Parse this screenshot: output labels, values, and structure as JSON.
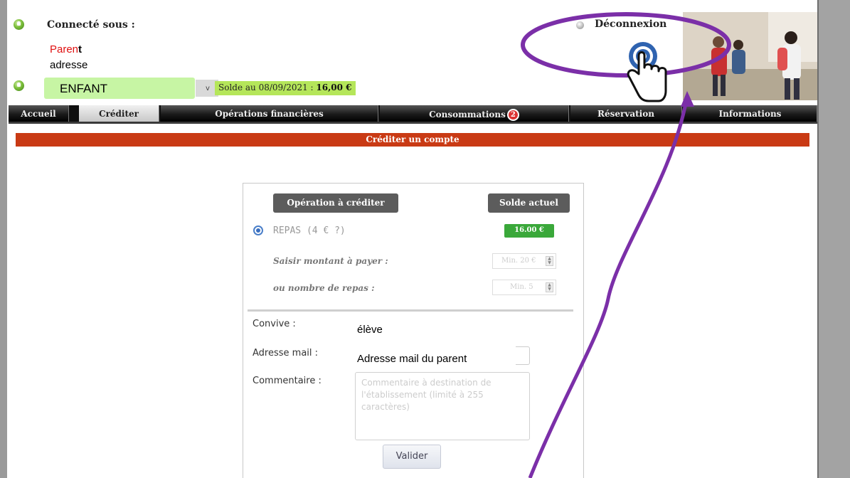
{
  "header": {
    "connected_label": "Connecté sous :",
    "parent_name": "Paren",
    "parent_name_end": "t",
    "address": "adresse",
    "child_select_value": "ENFANT",
    "select_arrow": "v",
    "balance_label": "Solde au 08/09/2021 : ",
    "balance_amount": "16,00 €",
    "logout_label": "Déconnexion"
  },
  "nav": {
    "items": [
      {
        "label": "Accueil"
      },
      {
        "label": "Créditer"
      },
      {
        "label": "Opérations financières"
      },
      {
        "label": "Consommations"
      },
      {
        "label": "Réservation"
      },
      {
        "label": "Informations"
      }
    ],
    "active_index": 1,
    "consommations_badge": "2"
  },
  "section_title": "Créditer un compte",
  "form": {
    "col_operation": "Opération à créditer",
    "col_balance": "Solde actuel",
    "operation_label": "REPAS (4 € ?)",
    "current_balance": "16.00 €",
    "amount_label": "Saisir montant à payer :",
    "amount_placeholder": "Min. 20 €",
    "meals_label": "ou nombre de repas :",
    "meals_placeholder": "Min. 5",
    "guest_label": "Convive :",
    "guest_value": "élève",
    "email_label": "Adresse mail :",
    "email_value": "Adresse mail du parent",
    "comment_label": "Commentaire :",
    "comment_placeholder": "Commentaire à destination de l'établissement (limité à 255 caractères)",
    "submit_label": "Valider"
  },
  "annotation": {
    "accent_color": "#7b2fa8",
    "highlight_target": "Déconnexion",
    "icons": [
      "hand-pointer-icon",
      "curved-arrow-icon",
      "highlight-ellipse"
    ]
  }
}
